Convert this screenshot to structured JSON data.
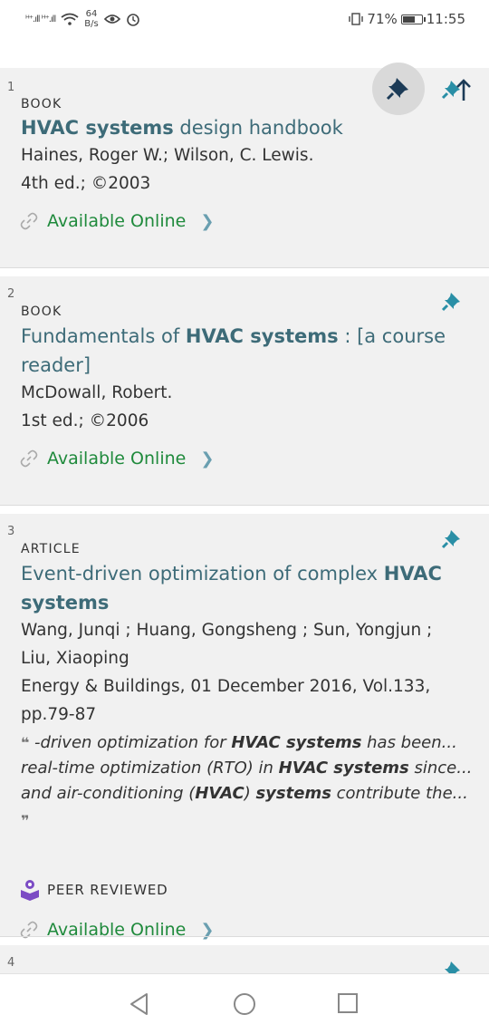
{
  "status_bar": {
    "signal_text": "ᴴ⁺.ıll ᴴ⁺.ıll",
    "speed_value": "64",
    "speed_unit": "B/s",
    "battery_percent": "71%",
    "battery_level": 0.71,
    "time": "11:55"
  },
  "results": [
    {
      "number": "1",
      "type": "BOOK",
      "title_html": "<b>HVAC systems</b> design handbook",
      "authors": "Haines, Roger W.; Wilson, C. Lewis.",
      "edition": "4th ed.; ©2003",
      "availability": "Available Online"
    },
    {
      "number": "2",
      "type": "BOOK",
      "title_html": "Fundamentals of <b>HVAC systems</b> : [a course reader]",
      "authors": "McDowall, Robert.",
      "edition": "1st ed.; ©2006",
      "availability": "Available Online"
    },
    {
      "number": "3",
      "type": "ARTICLE",
      "title_html": "Event-driven optimization of complex <b>HVAC systems</b>",
      "authors_line1": "Wang, Junqi ; Huang, Gongsheng ; Sun, Yongjun ;",
      "authors_line2": "Liu, Xiaoping",
      "source_line1": "Energy & Buildings, 01 December 2016, Vol.133,",
      "source_line2": "pp.79-87",
      "snippet_rows": [
        "-driven optimization for <b>HVAC systems</b> has been...",
        "real-time optimization (RTO) in <b>HVAC systems</b> since...",
        "and air-conditioning (<b>HVAC</b>) <b>systems</b> contribute the..."
      ],
      "peer_reviewed": "PEER REVIEWED",
      "availability": "Available Online"
    },
    {
      "number": "4"
    }
  ],
  "icons": {
    "pin": "pin-icon",
    "back_to_top": "arrow-up-icon",
    "link": "link-icon",
    "chevron": "chevron-right-icon",
    "peer": "peer-reviewed-icon"
  },
  "colors": {
    "title": "#3d6b78",
    "online": "#1f8a3c",
    "pin": "#2a8fa6",
    "pin_active": "#1c3b57",
    "peer": "#7b4bc4"
  }
}
